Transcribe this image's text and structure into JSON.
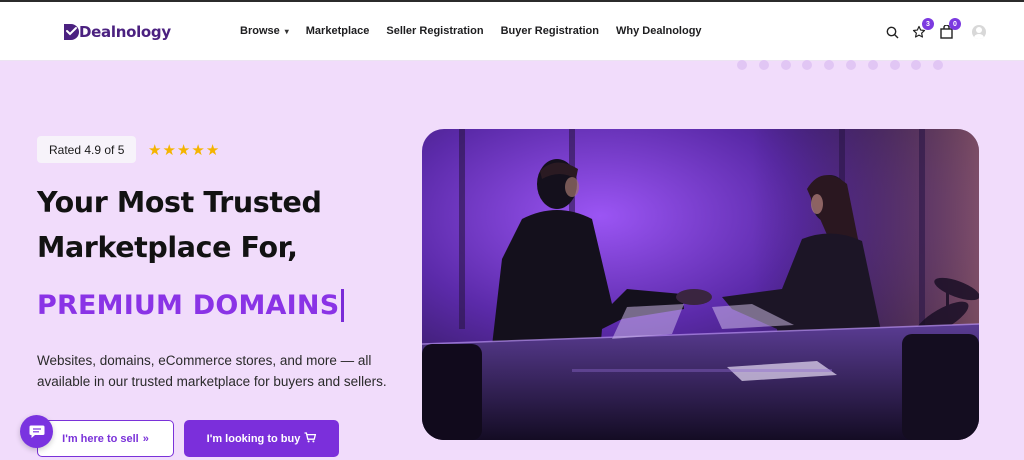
{
  "brand": {
    "name": "Dealnology",
    "accent": "#7b2fdb",
    "heading_color": "#121212",
    "hero_bg": "#f1dcfb"
  },
  "nav": {
    "items": [
      {
        "label": "Browse",
        "has_dropdown": true
      },
      {
        "label": "Marketplace"
      },
      {
        "label": "Seller Registration"
      },
      {
        "label": "Buyer Registration"
      },
      {
        "label": "Why Dealnology"
      }
    ]
  },
  "header_icons": {
    "search": "search-icon",
    "wishlist": {
      "icon": "star-icon",
      "count": "3"
    },
    "cart": {
      "icon": "bag-icon",
      "count": "0"
    },
    "account": "user-avatar-icon"
  },
  "hero": {
    "rating_text": "Rated 4.9 of 5",
    "stars": 5,
    "heading_line1": "Your Most Trusted",
    "heading_line2": "Marketplace For,",
    "typed_text": "PREMIUM DOMAINS",
    "description": "Websites, domains, eCommerce stores, and more — all available in our trusted marketplace for buyers and sellers.",
    "sell_button": "I'm here to sell",
    "buy_button": "I'm looking to buy",
    "image": "business-handshake-photo"
  },
  "chat": {
    "icon": "chat-bubble-icon"
  }
}
